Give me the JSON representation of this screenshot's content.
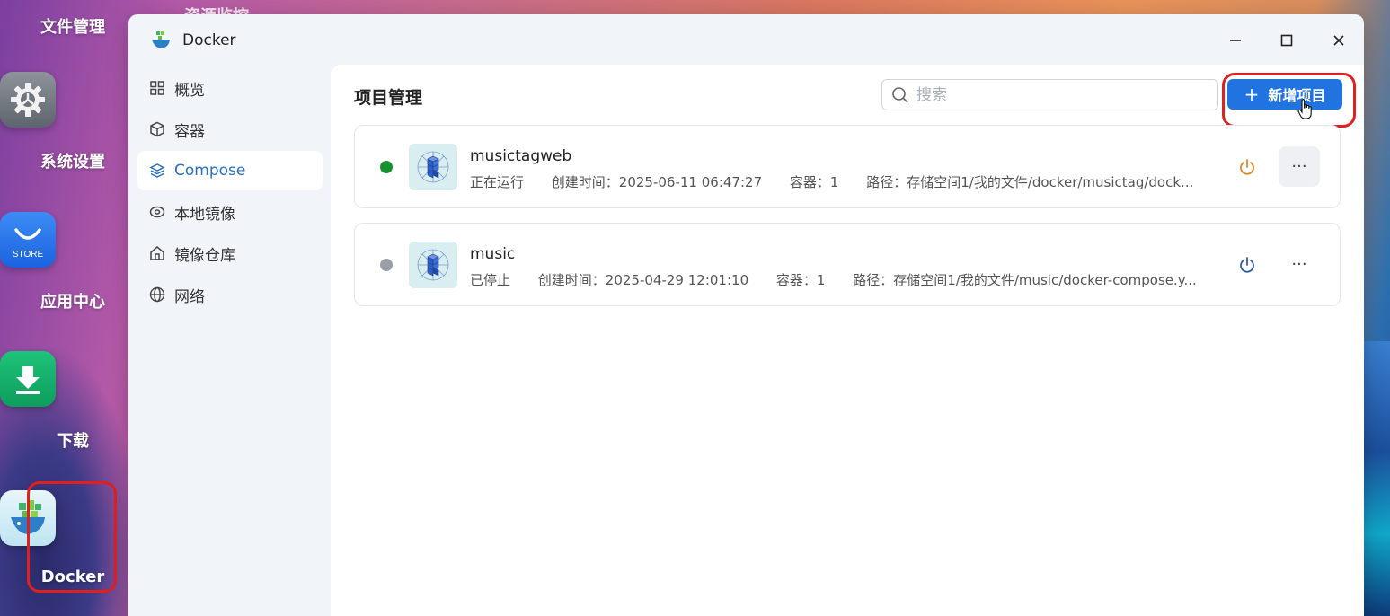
{
  "desktop": {
    "top_label": "文件管理",
    "partial_label": "资源监控",
    "apps": [
      {
        "label": "系统设置",
        "icon": "gear-icon"
      },
      {
        "label": "应用中心",
        "icon": "store-icon",
        "icon_text": "STORE"
      },
      {
        "label": "下载",
        "icon": "download-icon"
      },
      {
        "label": "Docker",
        "icon": "docker-icon"
      }
    ]
  },
  "window": {
    "title": "Docker",
    "controls": [
      "minimize-icon",
      "maximize-icon",
      "close-icon"
    ]
  },
  "sidebar": {
    "items": [
      {
        "label": "概览",
        "icon": "grid-icon",
        "active": false
      },
      {
        "label": "容器",
        "icon": "cube-icon",
        "active": false
      },
      {
        "label": "Compose",
        "icon": "layers-icon",
        "active": true
      },
      {
        "label": "本地镜像",
        "icon": "disk-icon",
        "active": false
      },
      {
        "label": "镜像仓库",
        "icon": "house-icon",
        "active": false
      },
      {
        "label": "网络",
        "icon": "globe-icon",
        "active": false
      }
    ]
  },
  "main": {
    "title": "项目管理",
    "search": {
      "placeholder": "搜索",
      "value": ""
    },
    "add_button": {
      "plus": "+",
      "label": "新增项目"
    },
    "projects": [
      {
        "name": "musictagweb",
        "status": "正在运行",
        "status_color": "#15922f",
        "created": "创建时间：2025-06-11 06:47:27",
        "containers": "容器：1",
        "path": "路径：存储空间1/我的文件/docker/musictag/dock...",
        "power_color": "#d98a2b"
      },
      {
        "name": "music",
        "status": "已停止",
        "status_color": "#9aa0a8",
        "created": "创建时间：2025-04-29 12:01:10",
        "containers": "容器：1",
        "path": "路径：存储空间1/我的文件/music/docker-compose.y...",
        "power_color": "#2c5e9e"
      }
    ],
    "more_label": "···"
  }
}
